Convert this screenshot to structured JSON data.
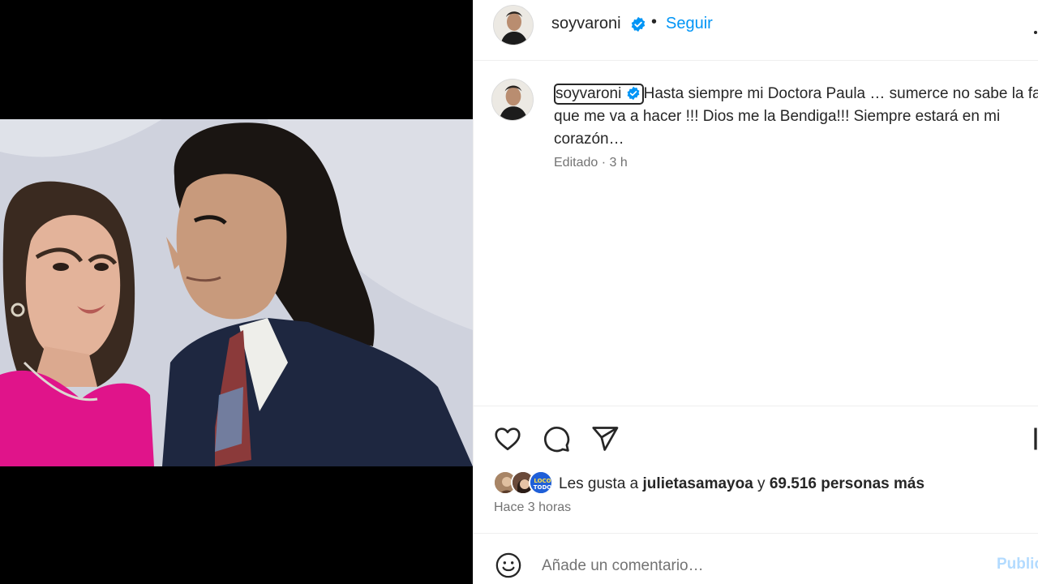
{
  "post": {
    "username": "soyvaroni",
    "follow_label": "Seguir",
    "separator": "•",
    "caption": "Hasta siempre mi Doctora Paula … sumerce no sabe la falta que me va a hacer !!! Dios me la Bendiga!!! Siempre estará en mi corazón…",
    "caption_meta": "Editado · 3 h",
    "likes_prefix": "Les gusta a ",
    "likes_user": "julietasamayoa",
    "likes_mid": " y ",
    "likes_count": "69.516 personas más",
    "time_ago": "Hace 3 horas",
    "comment_placeholder": "Añade un comentario…",
    "post_label": "Publicar",
    "liker_badge_text": "LOCO TODO"
  },
  "colors": {
    "accent": "#0095f6",
    "verified": "#0095f6",
    "text": "#262626",
    "muted": "#737373",
    "post_disabled": "#b3dbff"
  },
  "icons": [
    "verified-icon",
    "more-icon",
    "heart-icon",
    "comment-icon",
    "share-icon",
    "bookmark-icon",
    "emoji-icon"
  ]
}
